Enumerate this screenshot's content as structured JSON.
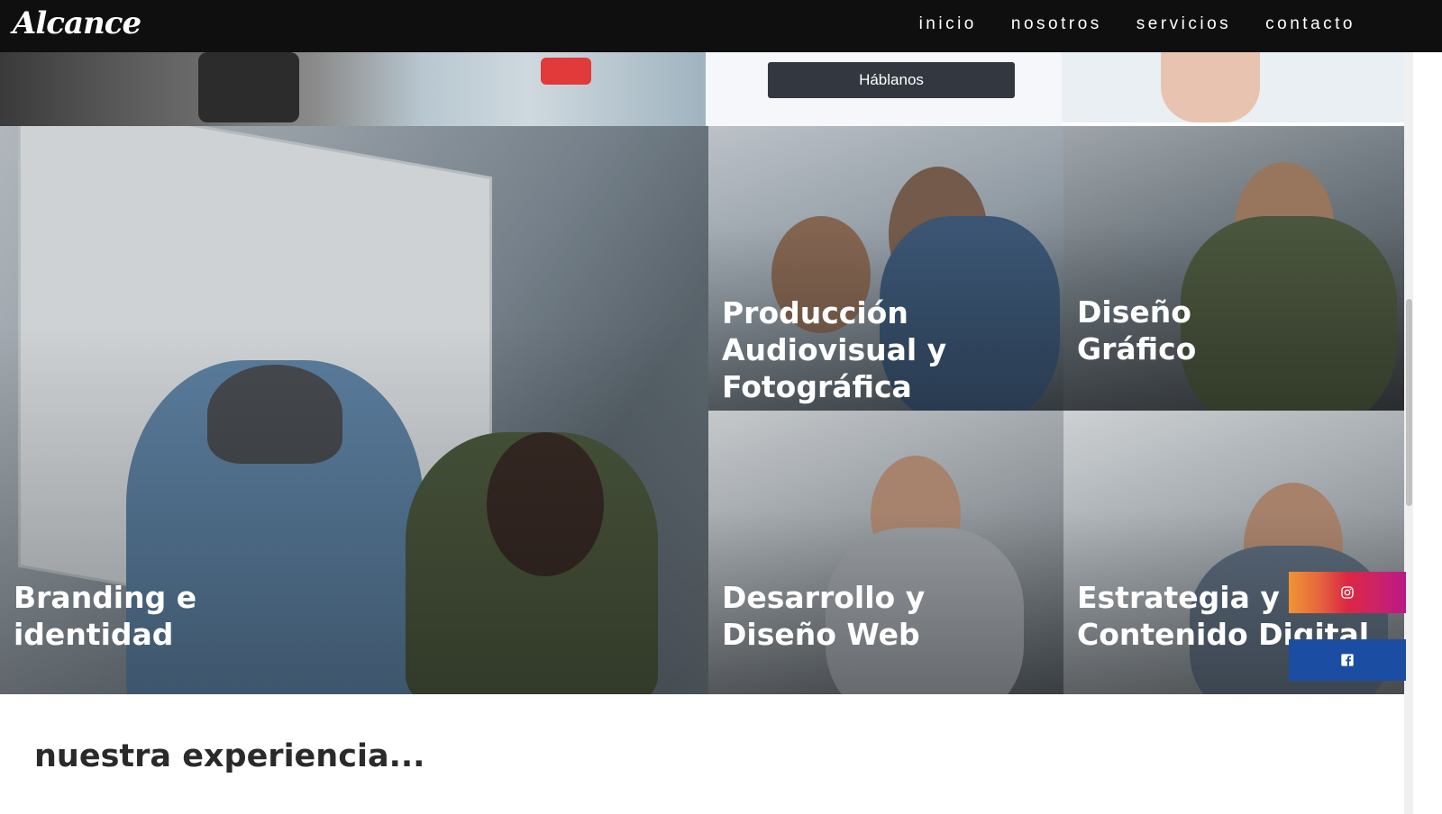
{
  "brand": {
    "logo_text": "Alcance"
  },
  "nav": {
    "items": [
      {
        "label": "inicio"
      },
      {
        "label": "nosotros"
      },
      {
        "label": "servicios"
      },
      {
        "label": "contacto"
      }
    ]
  },
  "hero": {
    "cta_label": "Háblanos"
  },
  "services": [
    {
      "title": "Branding e\nidentidad"
    },
    {
      "title": "Producción\nAudiovisual y\nFotográfica"
    },
    {
      "title": "Diseño\nGráfico"
    },
    {
      "title": "Desarrollo y\nDiseño Web"
    },
    {
      "title": "Estrategia y\nContenido Digital"
    }
  ],
  "social": {
    "instagram_icon": "instagram-icon",
    "facebook_icon": "facebook-icon"
  },
  "section": {
    "title": "nuestra experiencia..."
  }
}
